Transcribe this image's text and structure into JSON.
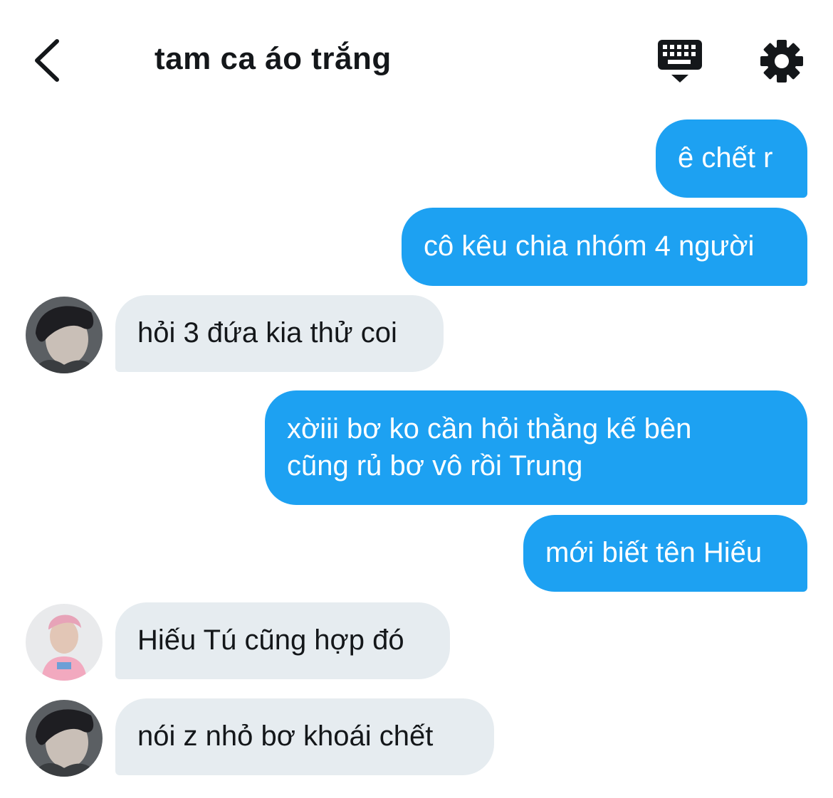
{
  "header": {
    "title": "tam ca áo trắng",
    "back_icon": "chevron-left-icon",
    "keyboard_icon": "keyboard-icon",
    "settings_icon": "gear-icon"
  },
  "colors": {
    "outgoing_bubble": "#1da1f2",
    "incoming_bubble": "#e6ecf0",
    "text_dark": "#14171a"
  },
  "messages": [
    {
      "direction": "outgoing",
      "lines": [
        "ê chết r"
      ]
    },
    {
      "direction": "outgoing",
      "lines": [
        "cô kêu chia nhóm 4 người"
      ]
    },
    {
      "direction": "incoming",
      "sender_avatar": "avatar-dark-hair",
      "lines": [
        "hỏi 3 đứa kia thử coi"
      ]
    },
    {
      "direction": "outgoing",
      "lines": [
        "xờiii bơ ko cần hỏi thằng kế bên",
        "cũng rủ bơ vô rồi Trung"
      ]
    },
    {
      "direction": "outgoing",
      "lines": [
        "mới biết tên Hiếu"
      ]
    },
    {
      "direction": "incoming",
      "sender_avatar": "avatar-pink-hair",
      "lines": [
        "Hiếu Tú cũng hợp đó"
      ]
    },
    {
      "direction": "incoming",
      "sender_avatar": "avatar-dark-hair",
      "lines": [
        "nói z nhỏ bơ khoái chết"
      ]
    }
  ]
}
